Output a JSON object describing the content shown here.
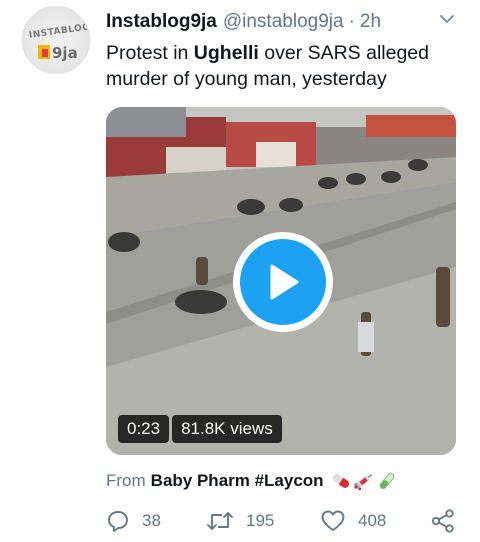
{
  "tweet": {
    "display_name": "Instablog9ja",
    "handle": "@instablog9ja",
    "separator": "·",
    "time": "2h",
    "text_parts": {
      "pre": "Protest in ",
      "bold": "Ughelli",
      "post": " over SARS alleged murder of young man, yesterday"
    },
    "avatar": {
      "logo_top": "INSTABLOG",
      "logo_bottom": "9ja"
    },
    "video": {
      "duration": "0:23",
      "views": "81.8K views"
    },
    "source": {
      "from_label": "From",
      "name": "Baby Pharm #Laycon"
    },
    "actions": {
      "replies": "38",
      "retweets": "195",
      "likes": "408"
    }
  },
  "icons": {
    "menu": "chevron-down-icon",
    "play": "play-icon",
    "reply": "reply-icon",
    "retweet": "retweet-icon",
    "like": "heart-icon",
    "share": "share-icon",
    "source_emojis": [
      "pill-icon",
      "syringe-icon",
      "test-tube-icon"
    ]
  },
  "colors": {
    "accent": "#1da1f2",
    "text_primary": "#14171a",
    "text_secondary": "#657786"
  }
}
